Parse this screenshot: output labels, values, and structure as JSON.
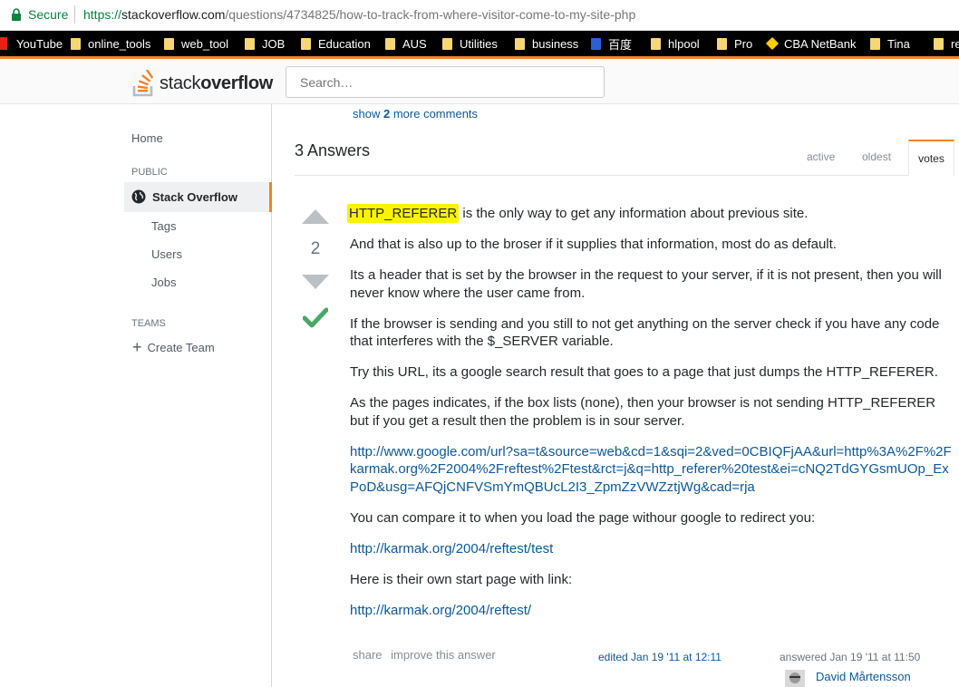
{
  "browser": {
    "secure_label": "Secure",
    "url_scheme": "https://",
    "url_host": "stackoverflow.com",
    "url_path": "/questions/4734825/how-to-track-from-where-visitor-come-to-my-site-php",
    "bookmarks": [
      "YouTube",
      "online_tools",
      "web_tool",
      "JOB",
      "Education",
      "AUS",
      "Utilities",
      "business",
      "百度",
      "hlpool",
      "Pro",
      "CBA NetBank",
      "Tina",
      "re"
    ]
  },
  "topbar": {
    "logo_text_plain": "stack",
    "logo_text_bold": "overflow",
    "search_placeholder": "Search…"
  },
  "sidebar": {
    "home": "Home",
    "public_label": "PUBLIC",
    "stack_overflow": "Stack Overflow",
    "tags": "Tags",
    "users": "Users",
    "jobs": "Jobs",
    "teams_label": "TEAMS",
    "create_team": "Create Team"
  },
  "comments": {
    "show_prefix": "show",
    "count": "2",
    "show_suffix": "more comments"
  },
  "answers": {
    "heading": "3 Answers",
    "tabs": [
      "active",
      "oldest",
      "votes"
    ],
    "active_tab": "votes"
  },
  "answer": {
    "votes": "2",
    "accepted": true,
    "highlight": "HTTP_REFERER",
    "p1_rest": " is the only way to get any information about previous site.",
    "p2": "And that is also up to the broser if it supplies that information, most do as default.",
    "p3": "Its a header that is set by the browser in the request to your server, if it is not present, then you will never know where the user came from.",
    "p4": "If the browser is sending and you still to not get anything on the server check if you have any code that interferes with the $_SERVER variable.",
    "p5": "Try this URL, its a google search result that goes to a page that just dumps the HTTP_REFERER.",
    "p6": "As the pages indicates, if the box lists (none), then your browser is not sending HTTP_REFERER but if you get a result then the problem is in sour server.",
    "link1": "http://www.google.com/url?sa=t&source=web&cd=1&sqi=2&ved=0CBIQFjAA&url=http%3A%2F%2Fkarmak.org%2F2004%2Freftest%2Ftest&rct=j&q=http_referer%20test&ei=cNQ2TdGYGsmUOp_ExPoD&usg=AFQjCNFVSmYmQBUcL2I3_ZpmZzVWZztjWg&cad=rja",
    "p7": "You can compare it to when you load the page withour google to redirect you:",
    "link2": "http://karmak.org/2004/reftest/test",
    "p8": "Here is their own start page with link:",
    "link3": "http://karmak.org/2004/reftest/",
    "menu_share": "share",
    "menu_improve": "improve this answer",
    "edited": "edited Jan 19 '11 at 12:11",
    "answered": "answered Jan 19 '11 at 11:50",
    "author": "David Mårtensson"
  },
  "colors": {
    "accent": "#f48024",
    "link": "#0c5897",
    "accepted_check": "#48a868",
    "highlight": "#fff200"
  }
}
